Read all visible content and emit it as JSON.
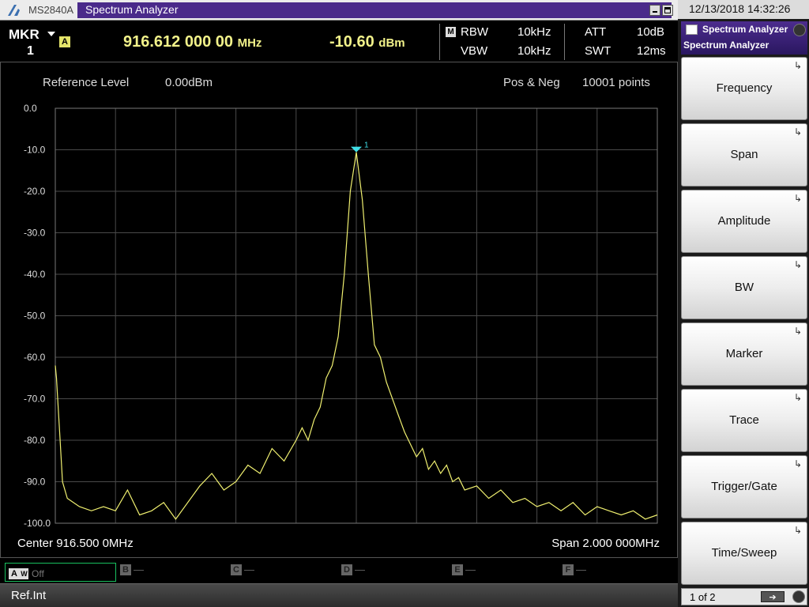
{
  "titlebar": {
    "model": "MS2840A",
    "title": "Spectrum Analyzer"
  },
  "marker": {
    "label": "MKR",
    "number": "1",
    "trace_badge": "A",
    "frequency": "916.612 000 00",
    "frequency_unit": "MHz",
    "level": "-10.60",
    "level_unit": "dBm"
  },
  "params": {
    "mode_badge": "M",
    "rbw_label": "RBW",
    "rbw_value": "10kHz",
    "vbw_label": "VBW",
    "vbw_value": "10kHz",
    "att_label": "ATT",
    "att_value": "10dB",
    "swt_label": "SWT",
    "swt_value": "12ms"
  },
  "panel": {
    "ref_label": "Reference Level",
    "ref_value": "0.00dBm",
    "detector": "Pos & Neg",
    "points": "10001 points",
    "center": "Center 916.500 0MHz",
    "span": "Span 2.000 000MHz"
  },
  "chart_data": {
    "type": "line",
    "title": "",
    "xlabel": "",
    "ylabel": "",
    "ylim": [
      -100,
      0
    ],
    "yticks": [
      "0.0",
      "-10.0",
      "-20.0",
      "-30.0",
      "-40.0",
      "-50.0",
      "-60.0",
      "-70.0",
      "-80.0",
      "-90.0",
      "-100.0"
    ],
    "grid": true,
    "series": [
      {
        "color": "#f0f070",
        "x": [
          0,
          0.2,
          0.4,
          0.8,
          1.2,
          2,
          4,
          6,
          8,
          10,
          12,
          14,
          16,
          18,
          20,
          24,
          26,
          28,
          30,
          32,
          34,
          36,
          38,
          40,
          41,
          42,
          43,
          44,
          45,
          46,
          47,
          48,
          49,
          50,
          51,
          52,
          53,
          54,
          55,
          56,
          57,
          58,
          59,
          60,
          61,
          62,
          63,
          64,
          65,
          66,
          67,
          68,
          70,
          72,
          74,
          76,
          78,
          80,
          82,
          84,
          86,
          88,
          90,
          92,
          94,
          96,
          98,
          100
        ],
        "y": [
          -62,
          -65,
          -70,
          -80,
          -90,
          -94,
          -96,
          -97,
          -96,
          -97,
          -92,
          -98,
          -97,
          -95,
          -99,
          -91,
          -88,
          -92,
          -90,
          -86,
          -88,
          -82,
          -85,
          -80,
          -77,
          -80,
          -75,
          -72,
          -65,
          -62,
          -55,
          -40,
          -20,
          -10.6,
          -22,
          -40,
          -57,
          -60,
          -66,
          -70,
          -74,
          -78,
          -81,
          -84,
          -82,
          -87,
          -85,
          -88,
          -86,
          -90,
          -89,
          -92,
          -91,
          -94,
          -92,
          -95,
          -94,
          -96,
          -95,
          -97,
          -95,
          -98,
          -96,
          -97,
          -98,
          -97,
          -99,
          -98
        ]
      }
    ],
    "marker": {
      "x": 50,
      "y": -10.6,
      "label": "1"
    }
  },
  "traces": {
    "a_letter": "A",
    "a_sub": "W",
    "a_state": "Off",
    "others": [
      "B",
      "C",
      "D",
      "E",
      "F"
    ],
    "dash": "—"
  },
  "status": {
    "text": "Ref.Int"
  },
  "rightpanel": {
    "datetime": "12/13/2018 14:32:26",
    "header_title": "Spectrum Analyzer",
    "header_sub": "Spectrum Analyzer",
    "softkeys": [
      "Frequency",
      "Span",
      "Amplitude",
      "BW",
      "Marker",
      "Trace",
      "Trigger/Gate",
      "Time/Sweep"
    ],
    "page": "1 of 2",
    "next_arrow": "➔",
    "arrow": "↳"
  }
}
